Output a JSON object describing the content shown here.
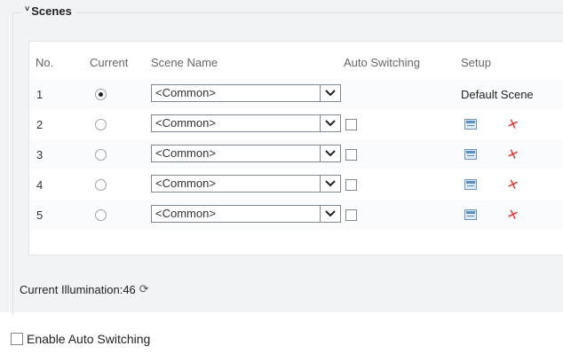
{
  "section": {
    "title": "Scenes",
    "collapse_glyph": "˅"
  },
  "table": {
    "headers": {
      "no": "No.",
      "current": "Current",
      "scene_name": "Scene Name",
      "auto_switching": "Auto Switching",
      "setup": "Setup"
    },
    "rows": [
      {
        "no": "1",
        "selected": true,
        "scene": "<Common>",
        "auto_checkbox": false,
        "setup_text": "Default Scene"
      },
      {
        "no": "2",
        "selected": false,
        "scene": "<Common>",
        "auto_checkbox": true,
        "setup_text": ""
      },
      {
        "no": "3",
        "selected": false,
        "scene": "<Common>",
        "auto_checkbox": true,
        "setup_text": ""
      },
      {
        "no": "4",
        "selected": false,
        "scene": "<Common>",
        "auto_checkbox": true,
        "setup_text": ""
      },
      {
        "no": "5",
        "selected": false,
        "scene": "<Common>",
        "auto_checkbox": true,
        "setup_text": ""
      }
    ]
  },
  "illumination": {
    "label": "Current Illumination:46",
    "refresh_glyph": "⟳"
  },
  "enable_auto_switching": {
    "label": "Enable Auto Switching",
    "checked": false
  },
  "colors": {
    "panel_bg": "#f2f3f5",
    "pin_red": "#e03535",
    "edit_blue": "#5a8fc5"
  },
  "icons": {
    "dropdown": "chevron-down-icon",
    "edit": "edit-icon",
    "delete": "pin-icon",
    "refresh": "refresh-icon"
  }
}
